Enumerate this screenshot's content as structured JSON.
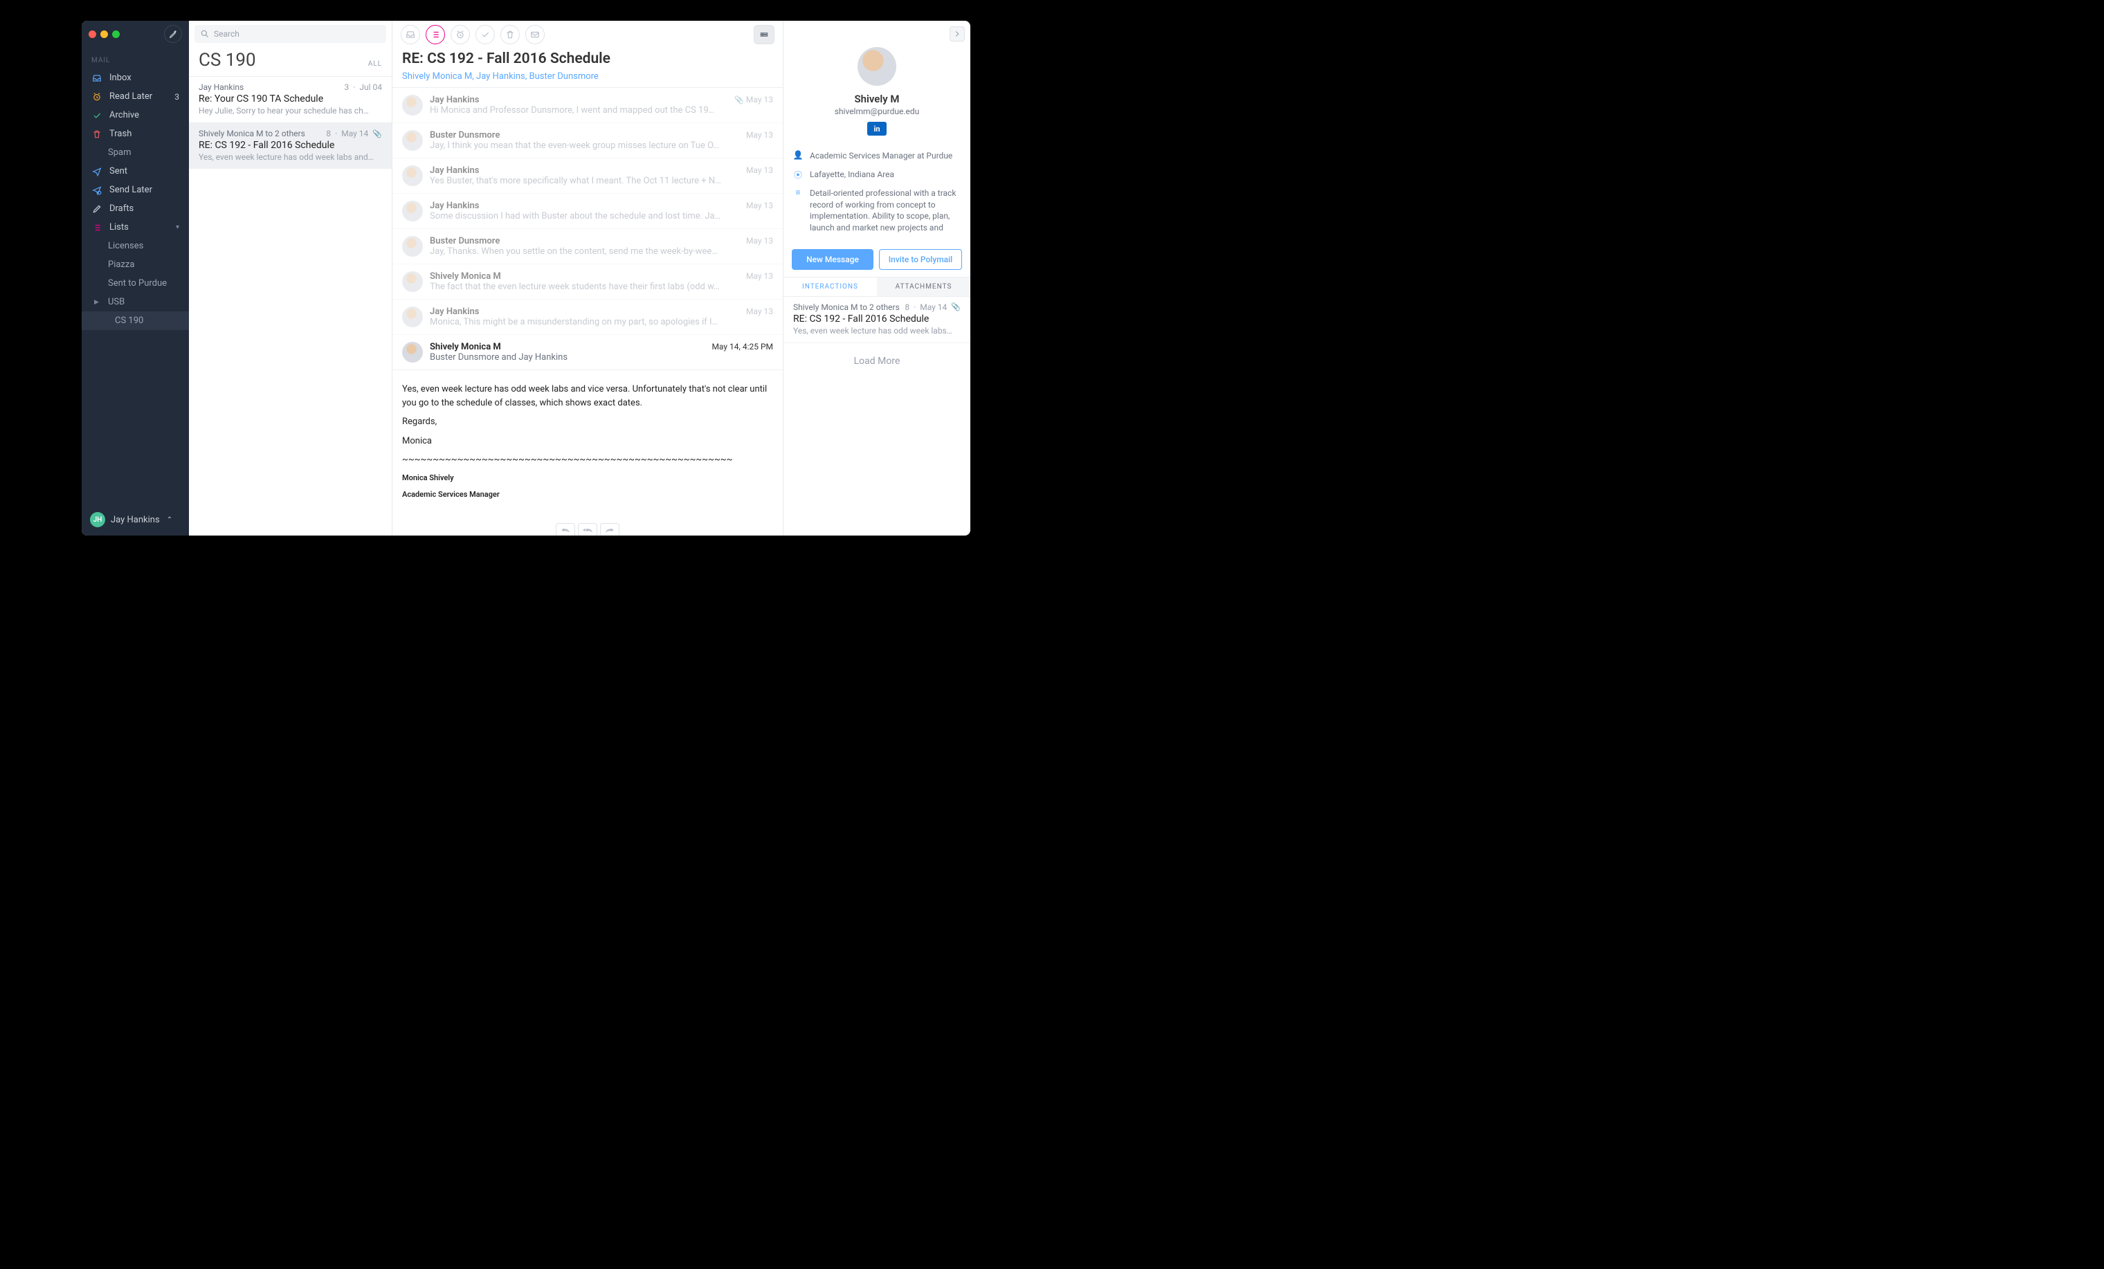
{
  "sidebar": {
    "section_label": "MAIL",
    "compose_tooltip": "Compose",
    "items": [
      {
        "icon": "inbox",
        "label": "Inbox",
        "color": "#5aa8ff"
      },
      {
        "icon": "clock",
        "label": "Read Later",
        "badge": "3",
        "color": "#f6a623"
      },
      {
        "icon": "check",
        "label": "Archive",
        "color": "#4ac29a"
      },
      {
        "icon": "trash",
        "label": "Trash",
        "color": "#ec5b62"
      },
      {
        "icon": "none",
        "label": "Spam",
        "sub": true
      },
      {
        "icon": "send",
        "label": "Sent",
        "color": "#5aa8ff"
      },
      {
        "icon": "sendlater",
        "label": "Send Later",
        "color": "#5aa8ff"
      },
      {
        "icon": "draft",
        "label": "Drafts",
        "color": "#c9cfd8"
      },
      {
        "icon": "lists",
        "label": "Lists",
        "color": "#ec008c",
        "caret": true
      },
      {
        "icon": "none",
        "label": "Licenses",
        "sub": true
      },
      {
        "icon": "none",
        "label": "Piazza",
        "sub": true
      },
      {
        "icon": "none",
        "label": "Sent to Purdue",
        "sub": true
      },
      {
        "icon": "folder",
        "label": "USB",
        "sub": true,
        "tri": true
      },
      {
        "icon": "none",
        "label": "CS 190",
        "sub": true,
        "selected": true,
        "indent": true
      }
    ],
    "footer": {
      "initials": "JH",
      "name": "Jay Hankins"
    }
  },
  "search_placeholder": "Search",
  "list": {
    "title": "CS 190",
    "filter": "ALL",
    "items": [
      {
        "from": "Jay Hankins",
        "count": "3",
        "date": "Jul 04",
        "subject": "Re: Your CS 190 TA Schedule",
        "snippet": "Hey Julie, Sorry to hear your schedule has ch…"
      },
      {
        "from": "Shively Monica M to 2 others",
        "count": "8",
        "date": "May 14",
        "attach": true,
        "subject": "RE: CS 192 - Fall 2016 Schedule",
        "snippet": "Yes, even week lecture has odd week labs and…",
        "active": true
      }
    ]
  },
  "thread": {
    "subject": "RE: CS 192 - Fall 2016 Schedule",
    "participants": "Shively Monica M, Jay Hankins, Buster Dunsmore",
    "messages": [
      {
        "from": "Jay Hankins",
        "preview": "Hi Monica and Professor Dunsmore, I went and mapped out the CS 19…",
        "when": "May 13",
        "attach": true
      },
      {
        "from": "Buster Dunsmore",
        "preview": "Jay, I think you mean that the even-week group misses lecture on Tue O…",
        "when": "May 13"
      },
      {
        "from": "Jay Hankins",
        "preview": "Yes Buster, that's more specifically what I meant. The Oct 11 lecture + N…",
        "when": "May 13"
      },
      {
        "from": "Jay Hankins",
        "preview": "Some discussion I had with Buster about the schedule and lost time. Ja…",
        "when": "May 13"
      },
      {
        "from": "Buster Dunsmore",
        "preview": "Jay, Thanks. When you settle on the content, send me the week-by-wee…",
        "when": "May 13"
      },
      {
        "from": "Shively Monica M",
        "preview": "The fact that the even lecture week students have their first labs (odd w…",
        "when": "May 13"
      },
      {
        "from": "Jay Hankins",
        "preview": "Monica, This might be a misunderstanding on my part, so apologies if I…",
        "when": "May 13"
      }
    ],
    "expanded": {
      "from": "Shively Monica M",
      "to": "Buster Dunsmore and Jay Hankins",
      "when": "May 14, 4:25 PM",
      "body": [
        "Yes, even week lecture has odd week labs and vice versa.  Unfortunately that's not clear until you go to the schedule of classes, which shows exact dates.",
        "Regards,",
        "Monica",
        "~~~~~~~~~~~~~~~~~~~~~~~~~~~~~~~~~~~~~~~~~~~~~~~~~~~~~~",
        "Monica Shively",
        "Academic Services Manager"
      ]
    }
  },
  "contact": {
    "name": "Shively M",
    "email": "shivelmm@purdue.edu",
    "title": "Academic Services Manager at Purdue",
    "location": "Lafayette, Indiana Area",
    "bio": "Detail-oriented professional with a track record of working from concept to implementation. Ability to scope, plan, launch and market new projects and programs. Diverse experience in higher education, including corporate partnerships, experiential learning",
    "new_message": "New Message",
    "invite": "Invite to Polymail",
    "tab_interactions": "INTERACTIONS",
    "tab_attachments": "ATTACHMENTS",
    "interactions": [
      {
        "from": "Shively Monica M to 2 others",
        "count": "8",
        "date": "May 14",
        "attach": true,
        "subject": "RE: CS 192 - Fall 2016 Schedule",
        "snippet": "Yes, even week lecture has odd week labs…"
      }
    ],
    "load_more": "Load More"
  }
}
